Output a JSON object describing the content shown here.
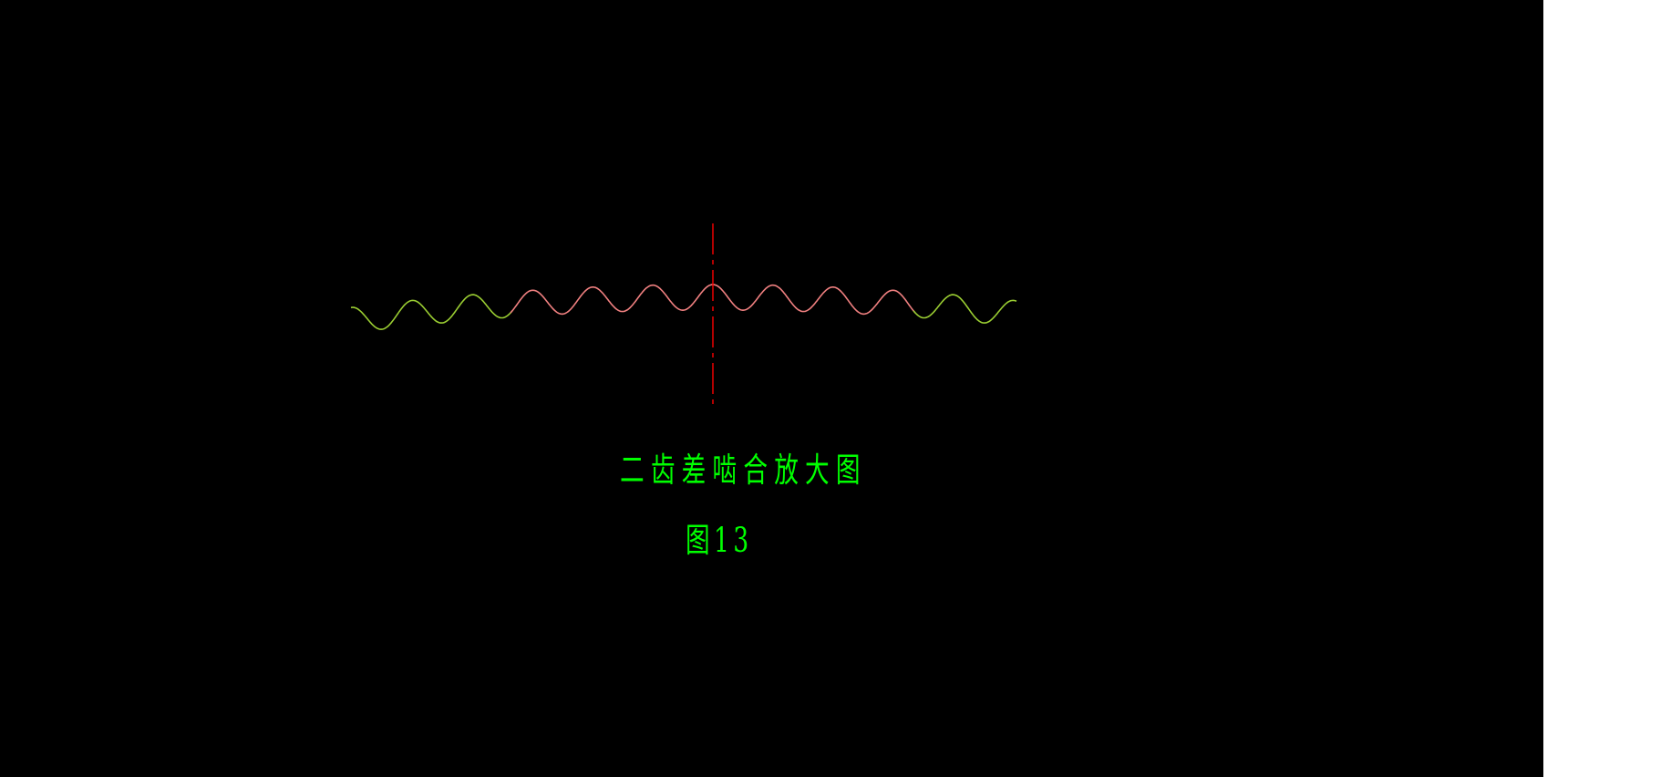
{
  "drawing": {
    "title": "二齿差啮合放大图",
    "figure_label": "图13",
    "colors": {
      "background": "#000000",
      "caption": "#00ff00",
      "center_line": "#ff0000",
      "outer_teeth": "#9acd32",
      "inner_teeth": "#f08080"
    }
  }
}
